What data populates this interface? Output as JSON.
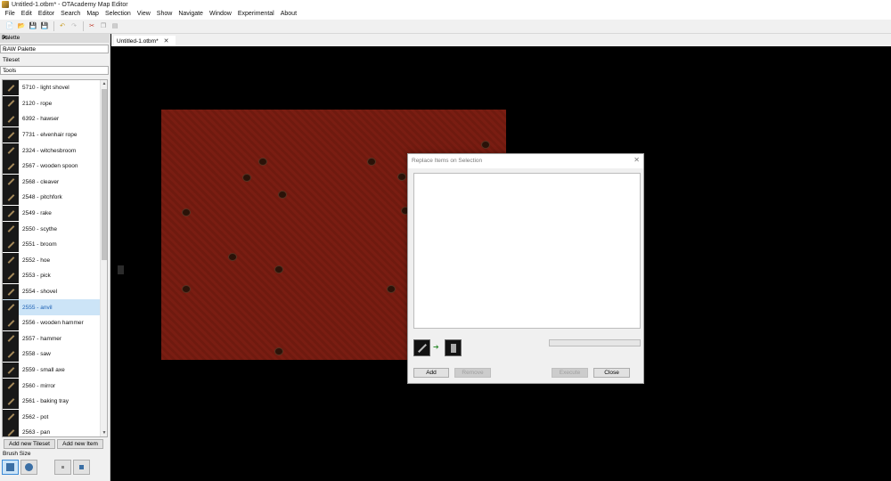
{
  "window": {
    "title": "Untitled-1.otbm* - OTAcademy Map Editor"
  },
  "menu": [
    "File",
    "Edit",
    "Editor",
    "Search",
    "Map",
    "Selection",
    "View",
    "Show",
    "Navigate",
    "Window",
    "Experimental",
    "About"
  ],
  "toolbar": {
    "icons": [
      "new-file-icon",
      "open-folder-icon",
      "save-icon",
      "save-as-icon",
      "undo-icon",
      "redo-icon",
      "cut-icon",
      "copy-icon",
      "paste-icon"
    ]
  },
  "palette": {
    "title": "Palette",
    "palette_type": "RAW Palette",
    "tileset_label": "Tileset",
    "tileset": "Tools",
    "items": [
      "5710 - light shovel",
      "2120 - rope",
      "6392 - hawser",
      "7731 - elvenhair rope",
      "2324 - witchesbroom",
      "2567 - wooden spoon",
      "2568 - cleaver",
      "2548 - pitchfork",
      "2549 - rake",
      "2550 - scythe",
      "2551 - broom",
      "2552 - hoe",
      "2553 - pick",
      "2554 - shovel",
      "2555 - anvil",
      "2556 - wooden hammer",
      "2557 - hammer",
      "2558 - saw",
      "2559 - small axe",
      "2560 - mirror",
      "2561 - baking tray",
      "2562 - pot",
      "2563 - pan"
    ],
    "selected_index": 14,
    "add_tileset_label": "Add new Tileset",
    "add_item_label": "Add new Item",
    "brush_size_label": "Brush Size"
  },
  "tabs": [
    {
      "label": "Untitled-1.otbm*"
    }
  ],
  "dialog": {
    "title": "Replace Items on Selection",
    "add_label": "Add",
    "remove_label": "Remove",
    "execute_label": "Execute",
    "close_label": "Close",
    "progress": 0
  },
  "colors": {
    "map_ground": "#7a1d12",
    "selection": "#cce4f7",
    "progress_fill": "#06b025"
  }
}
